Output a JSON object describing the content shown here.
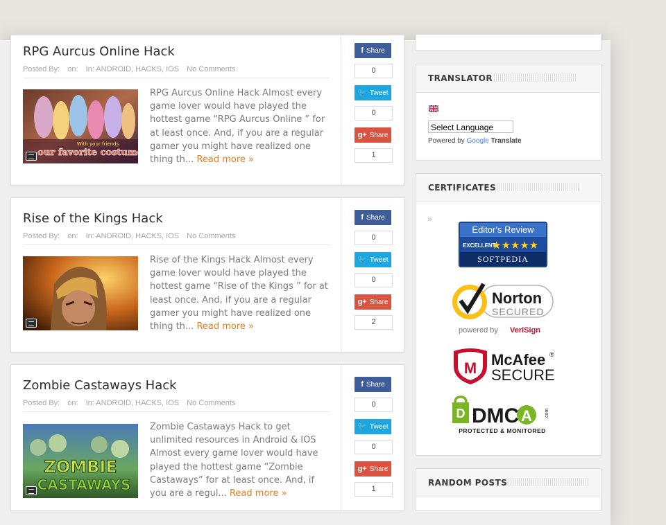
{
  "posts": [
    {
      "title": "RPG Aurcus Online Hack",
      "meta_posted_by": "Posted By:",
      "meta_on": "on:",
      "meta_in": "In: ANDROID, HACKS, IOS",
      "meta_comments": "No Comments",
      "excerpt": "RPG Aurcus Online Hack Almost every game lover would have played the hottest game “RPG Aurcus Online ” for at least once. And, if you are a regular gamer you might have realized one thing th...",
      "read_more": "Read more »",
      "thumb_caption_1": "With your friends",
      "thumb_caption_2": "our favorite costume!",
      "share": {
        "fb_label": "Share",
        "fb_count": "0",
        "tw_label": "Tweet",
        "tw_count": "0",
        "gp_label": "Share",
        "gp_count": "1"
      }
    },
    {
      "title": "Rise of the Kings Hack",
      "meta_posted_by": "Posted By:",
      "meta_on": "on:",
      "meta_in": "In: ANDROID, HACKS, IOS",
      "meta_comments": "No Comments",
      "excerpt": "Rise of the Kings Hack Almost every game lover would have played the hottest game “Rise of the Kings ” for at least once. And, if you are a regular gamer you might have realized one thing th...",
      "read_more": "Read more »",
      "share": {
        "fb_label": "Share",
        "fb_count": "0",
        "tw_label": "Tweet",
        "tw_count": "0",
        "gp_label": "Share",
        "gp_count": "2"
      }
    },
    {
      "title": "Zombie Castaways Hack",
      "meta_posted_by": "Posted By:",
      "meta_on": "on:",
      "meta_in": "In: ANDROID, HACKS, IOS",
      "meta_comments": "No Comments",
      "excerpt": "Zombie Castaways Hack to get unlimited resources in Android & IOS Almost every game lover would have played the hottest game “Zombie Castaways” for at least once. And, if you are a regul...",
      "read_more": "Read more »",
      "thumb_caption_1": "ZOMBIE",
      "thumb_caption_2": "CASTAWAYS",
      "share": {
        "fb_label": "Share",
        "fb_count": "0",
        "tw_label": "Tweet",
        "tw_count": "0",
        "gp_label": "Share",
        "gp_count": "1"
      }
    }
  ],
  "sidebar": {
    "translator": {
      "title": "TRANSLATOR",
      "select_value": "Select Language",
      "powered_by": "Powered by",
      "google": "Google",
      "translate": "Translate"
    },
    "certificates": {
      "title": "CERTIFICATES",
      "arrow": "»",
      "softpedia": {
        "line1": "Editor's Review",
        "line2": "EXCELLENT",
        "stars": "★★★★★",
        "line3": "SOFTPEDIA"
      },
      "norton": {
        "line1": "Norton",
        "line2": "SECURED",
        "line3": "powered by",
        "line4": "VeriSign"
      },
      "mcafee": {
        "line1": "McAfee",
        "line2": "SECURE",
        "reg": "®",
        "shield_letter": "M"
      },
      "dmca": {
        "d": "DMC",
        "a": "A",
        "com": ".com",
        "tagline": "PROTECTED & MONITORED"
      }
    },
    "random_posts": {
      "title": "RANDOM POSTS"
    }
  },
  "icons": {
    "facebook": "f",
    "twitter": "bird",
    "googleplus": "g+"
  },
  "colors": {
    "facebook": "#3f5e99",
    "twitter": "#1da6e0",
    "googleplus": "#d95440",
    "read_more": "#e57e1f"
  }
}
